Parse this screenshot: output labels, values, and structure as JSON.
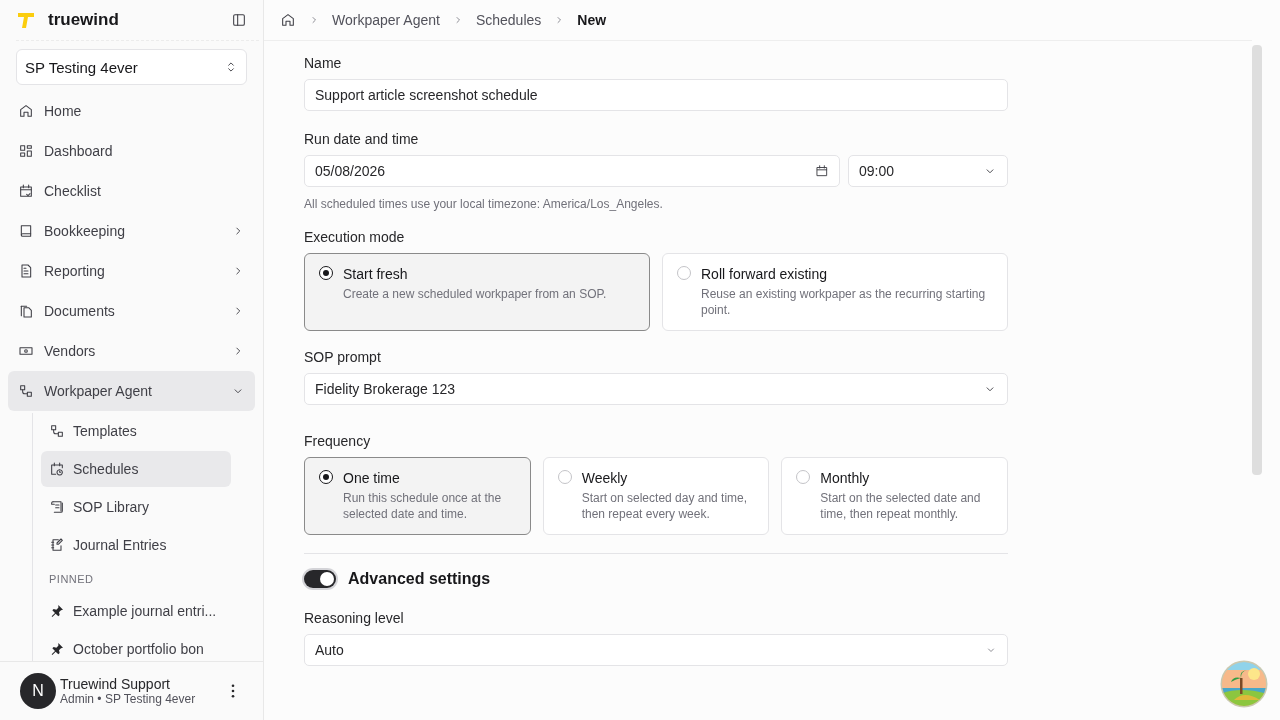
{
  "sidebar": {
    "brand": "truewind",
    "workspace": "SP Testing 4ever",
    "nav": [
      {
        "label": "Home",
        "kind": "link",
        "selected": false
      },
      {
        "label": "Dashboard",
        "kind": "link",
        "selected": false
      },
      {
        "label": "Checklist",
        "kind": "link",
        "selected": false
      },
      {
        "label": "Bookkeeping",
        "kind": "group",
        "selected": false,
        "expanded": false
      },
      {
        "label": "Reporting",
        "kind": "group",
        "selected": false,
        "expanded": false
      },
      {
        "label": "Documents",
        "kind": "group",
        "selected": false,
        "expanded": false
      },
      {
        "label": "Vendors",
        "kind": "group",
        "selected": false,
        "expanded": false
      },
      {
        "label": "Workpaper Agent",
        "kind": "group",
        "selected": true,
        "expanded": true,
        "children": [
          {
            "label": "Templates",
            "selected": false
          },
          {
            "label": "Schedules",
            "selected": true
          },
          {
            "label": "SOP Library",
            "selected": false
          },
          {
            "label": "Journal Entries",
            "selected": false
          }
        ],
        "pinned": {
          "heading": "PINNED",
          "items": [
            "Example journal entri...",
            "October portfolio bon"
          ]
        }
      }
    ],
    "user": {
      "initial": "N",
      "name": "Truewind Support",
      "detail": "Admin • SP Testing 4ever"
    }
  },
  "breadcrumb": [
    "Workpaper Agent",
    "Schedules",
    "New"
  ],
  "form": {
    "name": {
      "label": "Name",
      "value": "Support article screenshot schedule"
    },
    "run": {
      "label": "Run date and time",
      "date": "05/08/2026",
      "time": "09:00",
      "hint": "All scheduled times use your local timezone: America/Los_Angeles."
    },
    "execution_mode": {
      "label": "Execution mode",
      "options": [
        {
          "title": "Start fresh",
          "description": "Create a new scheduled workpaper from an SOP.",
          "selected": true
        },
        {
          "title": "Roll forward existing",
          "description": "Reuse an existing workpaper as the recurring starting point.",
          "selected": false
        }
      ]
    },
    "sop_prompt": {
      "label": "SOP prompt",
      "value": "Fidelity Brokerage 123"
    },
    "frequency": {
      "label": "Frequency",
      "options": [
        {
          "title": "One time",
          "description": "Run this schedule once at the selected date and time.",
          "selected": true
        },
        {
          "title": "Weekly",
          "description": "Start on selected day and time, then repeat every week.",
          "selected": false
        },
        {
          "title": "Monthly",
          "description": "Start on the selected date and time, then repeat monthly.",
          "selected": false
        }
      ]
    },
    "advanced_settings": {
      "label": "Advanced settings",
      "on": true
    },
    "reasoning_level": {
      "label": "Reasoning level",
      "value": "Auto"
    }
  }
}
